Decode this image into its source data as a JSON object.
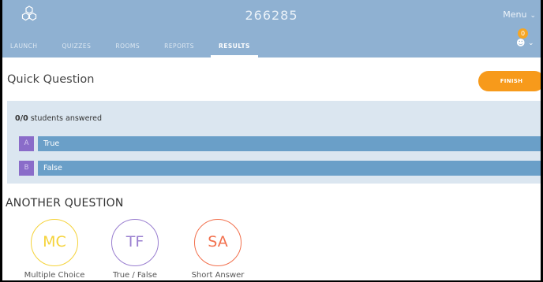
{
  "header": {
    "room_code": "266285",
    "menu_label": "Menu",
    "notification_count": "0",
    "tabs": [
      {
        "label": "LAUNCH"
      },
      {
        "label": "QUIZZES"
      },
      {
        "label": "ROOMS"
      },
      {
        "label": "REPORTS"
      },
      {
        "label": "RESULTS",
        "active": true
      }
    ]
  },
  "question": {
    "title": "Quick Question",
    "finish_label": "FINISH",
    "answered_count": "0/0",
    "answered_suffix": " students answered",
    "options": [
      {
        "letter": "A",
        "text": "True"
      },
      {
        "letter": "B",
        "text": "False"
      }
    ]
  },
  "another": {
    "heading": "ANOTHER QUESTION",
    "types": [
      {
        "abbr": "MC",
        "label": "Multiple Choice",
        "color": "#f5d33a"
      },
      {
        "abbr": "TF",
        "label": "True / False",
        "color": "#9a7fd0"
      },
      {
        "abbr": "SA",
        "label": "Short Answer",
        "color": "#f2704d"
      }
    ]
  },
  "colors": {
    "header_bg": "#8fb1d2",
    "finish_bg": "#f79a1b",
    "answer_panel_bg": "#dbe6f0",
    "answer_bar": "#6a9fc8",
    "letter_tile": "#8a6cc9"
  }
}
